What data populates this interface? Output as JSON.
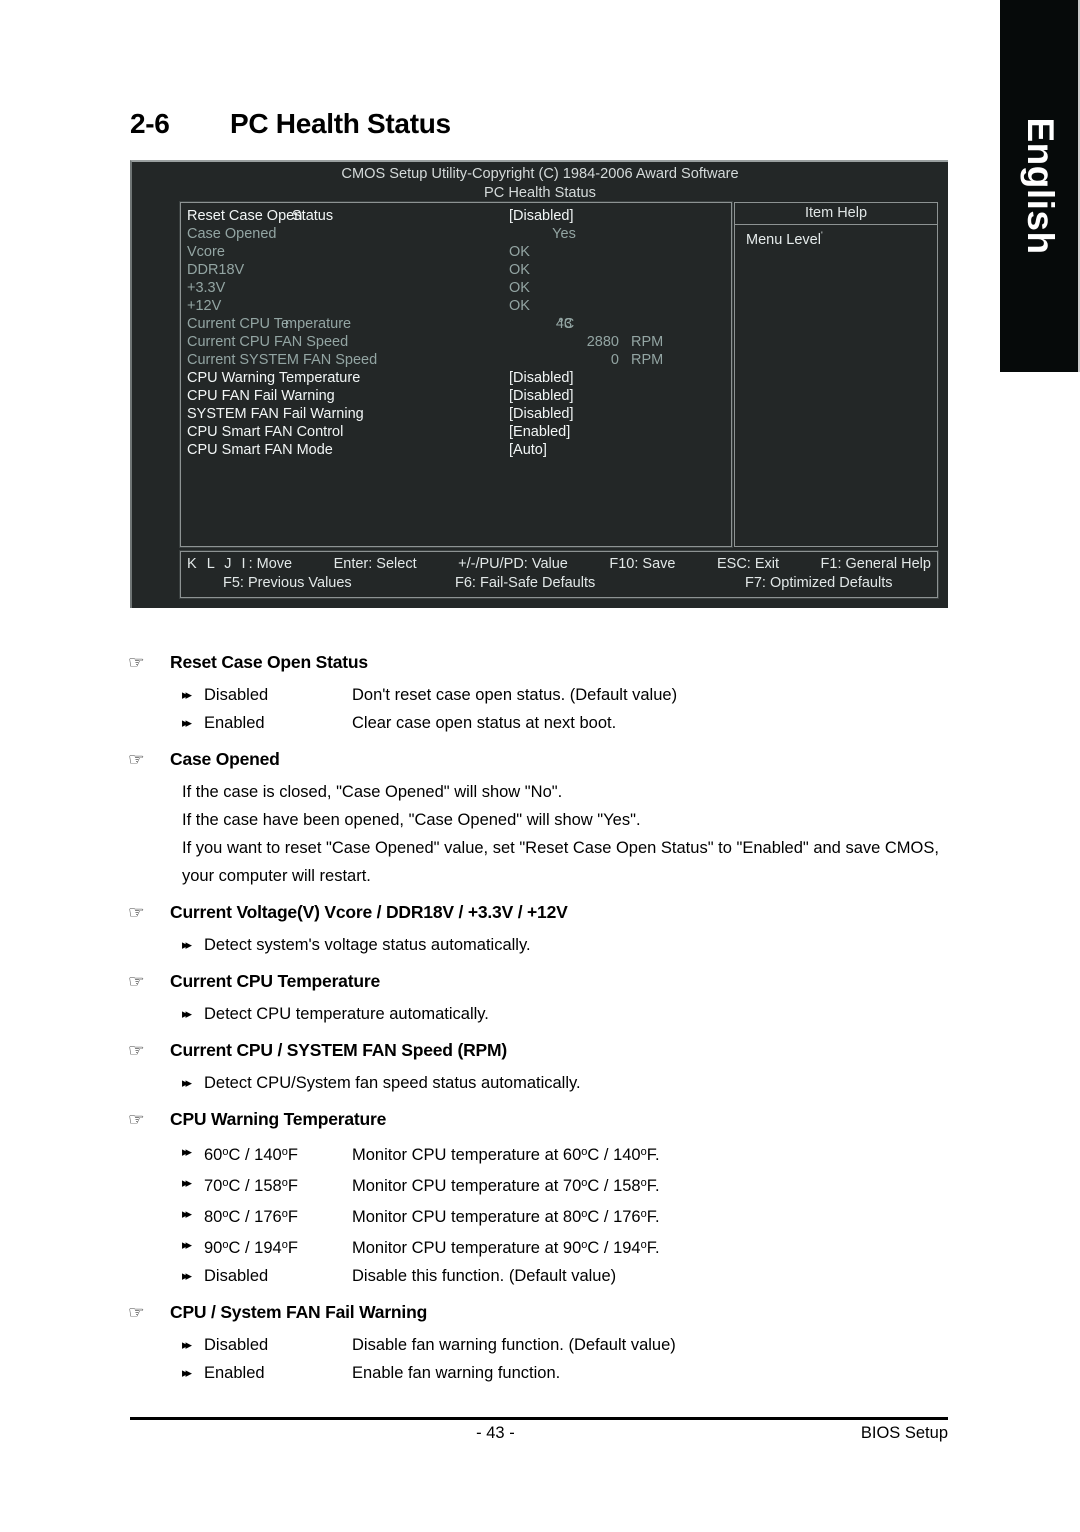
{
  "language_tab": {
    "label": "English"
  },
  "heading": {
    "number": "2-6",
    "title": "PC Health Status"
  },
  "bios": {
    "title_line1": "CMOS Setup Utility-Copyright (C) 1984-2006 Award Software",
    "title_line2": "PC Health Status",
    "item_help": {
      "title": "Item Help",
      "menu_level": "Menu Level",
      "menu_level_sup": "'"
    },
    "items": [
      {
        "label": "Reset Case Open",
        "label_overlap": "Status",
        "value": "[Disabled]",
        "style": "editable",
        "value_align": "left"
      },
      {
        "label": "Case Opened",
        "value": "Yes",
        "style": "readonly",
        "value_align": "center"
      },
      {
        "label": "Vcore",
        "value": "OK",
        "style": "readonly",
        "value_align": "left"
      },
      {
        "label": "DDR18V",
        "value": "OK",
        "style": "readonly",
        "value_align": "left"
      },
      {
        "label": "+3.3V",
        "value": "OK",
        "style": "readonly",
        "value_align": "left"
      },
      {
        "label": "+12V",
        "value": "OK",
        "style": "readonly",
        "value_align": "left"
      },
      {
        "label": "Current CPU Te",
        "label_overlap": "mperature",
        "value": "43",
        "value_overlap": "°C",
        "style": "readonly",
        "value_align": "temp"
      },
      {
        "label": "Current CPU FAN Speed",
        "value": "2880",
        "value_unit": "RPM",
        "style": "readonly",
        "value_align": "right-unit"
      },
      {
        "label": "Current SYSTEM FAN Speed",
        "value": "0",
        "value_unit": "RPM",
        "style": "readonly",
        "value_align": "right-unit"
      },
      {
        "label": "CPU Warning Temperature",
        "value": "[Disabled]",
        "style": "editable",
        "value_align": "left"
      },
      {
        "label": "CPU FAN Fail Warning",
        "value": "[Disabled]",
        "style": "editable",
        "value_align": "left"
      },
      {
        "label": "SYSTEM FAN Fail Warning",
        "value": "[Disabled]",
        "style": "editable",
        "value_align": "left"
      },
      {
        "label": "CPU Smart FAN Control",
        "value": "[Enabled]",
        "style": "editable",
        "value_align": "left"
      },
      {
        "label": "CPU Smart FAN Mode",
        "value": "[Auto]",
        "style": "editable",
        "value_align": "left"
      }
    ],
    "keys_line1": [
      "K L J I: Move",
      "Enter: Select",
      "+/-/PU/PD: Value",
      "F10: Save",
      "ESC: Exit",
      "F1: General Help"
    ],
    "keys_line2": [
      "F5: Previous Values",
      "F6: Fail-Safe Defaults",
      "F7: Optimized Defaults"
    ]
  },
  "icons": {
    "hand": "☞",
    "double_arrow": "▸▸"
  },
  "sections": [
    {
      "title": "Reset Case Open Status",
      "options": [
        {
          "term": "Disabled",
          "desc": "Don't reset case open status. (Default value)"
        },
        {
          "term": "Enabled",
          "desc": "Clear case open status at next boot."
        }
      ],
      "paragraphs": []
    },
    {
      "title": "Case Opened",
      "options": [],
      "paragraphs": [
        "If the case is closed, \"Case Opened\" will show \"No\".",
        "If the case have been opened, \"Case Opened\" will show \"Yes\".",
        "If you want to reset \"Case Opened\" value, set \"Reset Case Open Status\" to \"Enabled\" and save CMOS, your computer will restart."
      ]
    },
    {
      "title": "Current Voltage(V) Vcore / DDR18V / +3.3V / +12V",
      "options": [
        {
          "term": "",
          "desc": "Detect system's voltage status automatically."
        }
      ],
      "paragraphs": []
    },
    {
      "title": "Current CPU Temperature",
      "options": [
        {
          "term": "",
          "desc": "Detect CPU temperature automatically."
        }
      ],
      "paragraphs": []
    },
    {
      "title": "Current CPU / SYSTEM FAN Speed (RPM)",
      "options": [
        {
          "term": "",
          "desc": "Detect CPU/System fan speed status automatically."
        }
      ],
      "paragraphs": []
    },
    {
      "title": "CPU Warning Temperature",
      "options": [
        {
          "term_html": "60<sup class=\"deg\">o</sup>C / 140<sup class=\"deg\">o</sup>F",
          "desc_html": "Monitor CPU temperature at 60<sup class=\"deg\">o</sup>C / 140<sup class=\"deg\">o</sup>F."
        },
        {
          "term_html": "70<sup class=\"deg\">o</sup>C / 158<sup class=\"deg\">o</sup>F",
          "desc_html": "Monitor CPU temperature at 70<sup class=\"deg\">o</sup>C / 158<sup class=\"deg\">o</sup>F."
        },
        {
          "term_html": "80<sup class=\"deg\">o</sup>C / 176<sup class=\"deg\">o</sup>F",
          "desc_html": "Monitor CPU temperature at 80<sup class=\"deg\">o</sup>C / 176<sup class=\"deg\">o</sup>F."
        },
        {
          "term_html": "90<sup class=\"deg\">o</sup>C / 194<sup class=\"deg\">o</sup>F",
          "desc_html": "Monitor CPU temperature at 90<sup class=\"deg\">o</sup>C / 194<sup class=\"deg\">o</sup>F."
        },
        {
          "term": "Disabled",
          "desc": "Disable this function. (Default value)"
        }
      ],
      "paragraphs": []
    },
    {
      "title": "CPU / System FAN Fail Warning",
      "options": [
        {
          "term": "Disabled",
          "desc": "Disable fan warning function. (Default value)"
        },
        {
          "term": "Enabled",
          "desc": "Enable fan warning function."
        }
      ],
      "paragraphs": []
    }
  ],
  "footer": {
    "page": "- 43 -",
    "label": "BIOS Setup"
  }
}
